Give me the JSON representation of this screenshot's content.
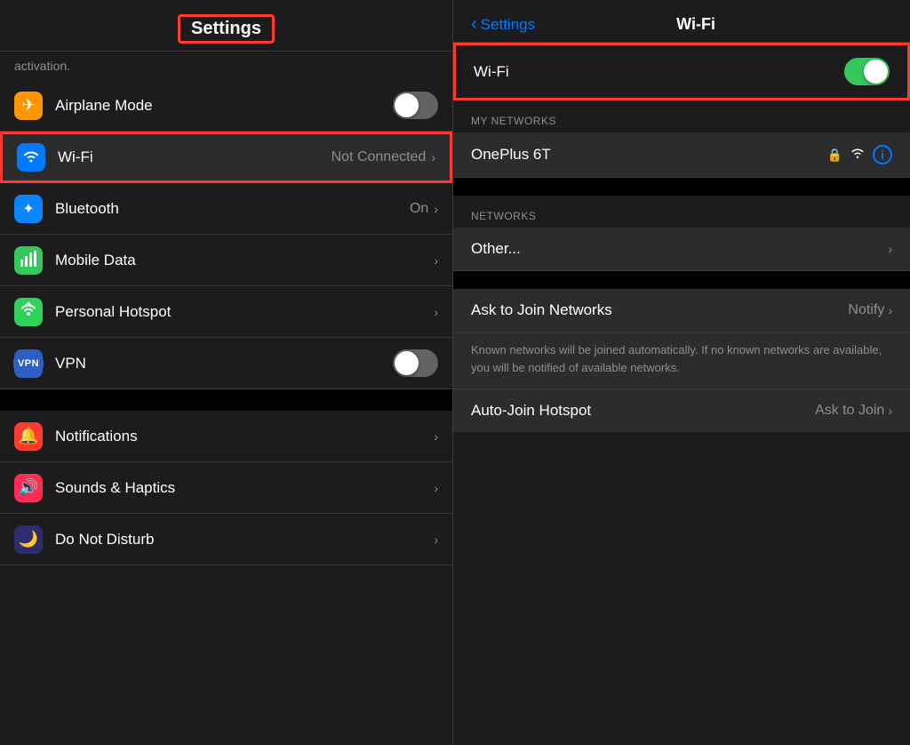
{
  "left": {
    "header": {
      "title": "Settings"
    },
    "activation_text": "activation.",
    "rows": [
      {
        "id": "airplane-mode",
        "label": "Airplane Mode",
        "icon_color": "orange",
        "icon_symbol": "✈",
        "toggle": true,
        "toggle_state": "off",
        "highlighted": false
      },
      {
        "id": "wifi",
        "label": "Wi-Fi",
        "icon_color": "blue",
        "icon_symbol": "wifi",
        "value": "Not Connected",
        "chevron": true,
        "highlighted": true
      },
      {
        "id": "bluetooth",
        "label": "Bluetooth",
        "icon_color": "blue-dark",
        "icon_symbol": "bluetooth",
        "value": "On",
        "chevron": true
      },
      {
        "id": "mobile-data",
        "label": "Mobile Data",
        "icon_color": "green",
        "icon_symbol": "signal",
        "chevron": true
      },
      {
        "id": "personal-hotspot",
        "label": "Personal Hotspot",
        "icon_color": "green",
        "icon_symbol": "hotspot",
        "chevron": true
      },
      {
        "id": "vpn",
        "label": "VPN",
        "icon_color": "vpn-blue",
        "icon_symbol": "VPN",
        "toggle": true,
        "toggle_state": "off"
      }
    ],
    "section2_rows": [
      {
        "id": "notifications",
        "label": "Notifications",
        "icon_color": "red",
        "icon_symbol": "🔔",
        "chevron": true
      },
      {
        "id": "sounds-haptics",
        "label": "Sounds & Haptics",
        "icon_color": "pink",
        "icon_symbol": "🔊",
        "chevron": true
      },
      {
        "id": "do-not-disturb",
        "label": "Do Not Disturb",
        "icon_color": "moon",
        "icon_symbol": "🌙",
        "chevron": true
      }
    ]
  },
  "right": {
    "back_label": "Settings",
    "page_title": "Wi-Fi",
    "wifi_toggle_label": "Wi-Fi",
    "wifi_toggle_state": "on",
    "my_networks_label": "MY NETWORKS",
    "networks_label": "NETWORKS",
    "network": {
      "name": "OnePlus 6T"
    },
    "other_label": "Other...",
    "ask_join_label": "Ask to Join Networks",
    "ask_join_value": "Notify",
    "info_text": "Known networks will be joined automatically. If no known networks are available, you will be notified of available networks.",
    "auto_join_label": "Auto-Join Hotspot",
    "auto_join_value": "Ask to Join"
  }
}
